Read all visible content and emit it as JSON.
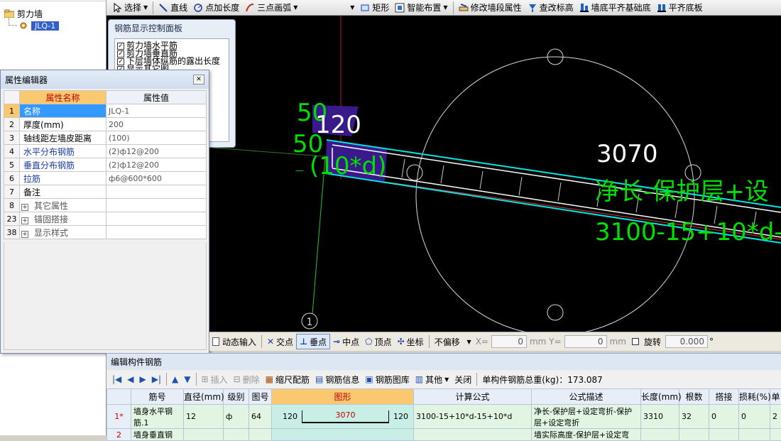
{
  "tree": {
    "root_label": "剪力墙",
    "child_label": "JLQ-1"
  },
  "toolbar": {
    "items": [
      {
        "icon": "cursor-icon",
        "label": "选择",
        "dropdown": true
      },
      {
        "icon": "line-icon",
        "label": "直线",
        "dropdown": false
      },
      {
        "icon": "point-length-icon",
        "label": "点加长度",
        "dropdown": false
      },
      {
        "icon": "arc-icon",
        "label": "三点画弧",
        "dropdown": true
      },
      {
        "icon": "dropdown-icon",
        "label": "",
        "dropdown": true
      },
      {
        "icon": "rectangle-icon",
        "label": "矩形",
        "dropdown": false
      },
      {
        "icon": "smart-layout-icon",
        "label": "智能布置",
        "dropdown": true
      },
      {
        "icon": "edit-wall-icon",
        "label": "修改墙段属性",
        "dropdown": false
      },
      {
        "icon": "check-elevation-icon",
        "label": "查改标高",
        "dropdown": false
      },
      {
        "icon": "wall-align-icon",
        "label": "墙底平齐基础底",
        "dropdown": false
      },
      {
        "icon": "align-slab-icon",
        "label": "平齐底板",
        "dropdown": false
      }
    ]
  },
  "control_panel": {
    "title": "钢筋显示控制面板",
    "options": [
      {
        "label": "剪力墙水平筋",
        "checked": true
      },
      {
        "label": "剪力墙垂直筋",
        "checked": true
      },
      {
        "label": "下层墙体纵筋的露出长度",
        "checked": true
      },
      {
        "label": "显示其它图",
        "checked": true
      }
    ]
  },
  "viewport": {
    "labels": {
      "top_dim_1": "50",
      "top_dim_2": "120",
      "side_dim": "50",
      "formula_small": "(10*d)",
      "length": "3070",
      "formula_desc": "净长-保护层+设",
      "formula_calc": "3100-15+10*d-",
      "axis_marker": "1"
    },
    "colors": {
      "background": "#000000",
      "wall_outline": "#00e5e5",
      "axis_red": "#e03030",
      "axis_green": "#30c030",
      "annotation_green": "#00e000",
      "highlight_purple": "#3a1a8a"
    }
  },
  "property_editor": {
    "title": "属性编辑器",
    "col_name": "属性名称",
    "col_value": "属性值",
    "rows": [
      {
        "num": "1",
        "name": "名称",
        "value": "JLQ-1",
        "style": "sel",
        "expand": false
      },
      {
        "num": "2",
        "name": "厚度(mm)",
        "value": "200",
        "style": "",
        "expand": false
      },
      {
        "num": "3",
        "name": "轴线距左墙皮距离",
        "value": "(100)",
        "style": "",
        "expand": false
      },
      {
        "num": "4",
        "name": "水平分布钢筋",
        "value": "(2)ф12@200",
        "style": "blue",
        "expand": false
      },
      {
        "num": "5",
        "name": "垂直分布钢筋",
        "value": "(2)ф12@200",
        "style": "blue",
        "expand": false
      },
      {
        "num": "6",
        "name": "拉筋",
        "value": "ф6@600*600",
        "style": "blue",
        "expand": false
      },
      {
        "num": "7",
        "name": "备注",
        "value": "",
        "style": "",
        "expand": false
      },
      {
        "num": "8",
        "name": "其它属性",
        "value": "",
        "style": "grey",
        "expand": true
      },
      {
        "num": "23",
        "name": "锚固搭接",
        "value": "",
        "style": "grey",
        "expand": true
      },
      {
        "num": "38",
        "name": "显示样式",
        "value": "",
        "style": "grey",
        "expand": true
      }
    ]
  },
  "snap_bar": {
    "dynamic_input": "动态输入",
    "intersection": "交点",
    "perpendicular": "垂点",
    "midpoint": "中点",
    "vertex": "顶点",
    "coordinate": "坐标",
    "offset_select": "不偏移",
    "x_label": "X=",
    "x_value": "0",
    "y_label": "mm Y=",
    "y_value": "0",
    "mm_label": "mm",
    "rotate_label": "旋转",
    "rotate_value": "0.000",
    "degree": "°"
  },
  "rebar_panel": {
    "title": "编辑构件钢筋",
    "toolbar": {
      "insert": "插入",
      "delete": "删除",
      "scale": "缩尺配筋",
      "info": "钢筋信息",
      "library": "钢筋图库",
      "other": "其他",
      "close": "关闭",
      "total": "单构件钢筋总重(kg)：173.087"
    },
    "columns": [
      "",
      "筋号",
      "直径(mm)",
      "级别",
      "图号",
      "图形",
      "计算公式",
      "公式描述",
      "长度(mm)",
      "根数",
      "搭接",
      "损耗(%)",
      "单"
    ],
    "rows": [
      {
        "rn": "1*",
        "name": "墙身水平钢筋.1",
        "dia": "12",
        "grade": "ф",
        "fig": "64",
        "shape_left": "120",
        "shape_mid": "3070",
        "shape_right": "120",
        "formula": "3100-15+10*d-15+10*d",
        "desc": "净长-保护层+设定弯折-保护层+设定弯折",
        "length": "3310",
        "count": "32",
        "lap": "0",
        "loss": "0",
        "unit": "2"
      },
      {
        "rn": "2",
        "name": "墙身垂直钢",
        "dia": "",
        "grade": "",
        "fig": "",
        "shape_left": "",
        "shape_mid": "",
        "shape_right": "",
        "formula": "",
        "desc": "墙实际高度-保护层+设定弯",
        "length": "",
        "count": "",
        "lap": "",
        "loss": "",
        "unit": ""
      }
    ]
  }
}
